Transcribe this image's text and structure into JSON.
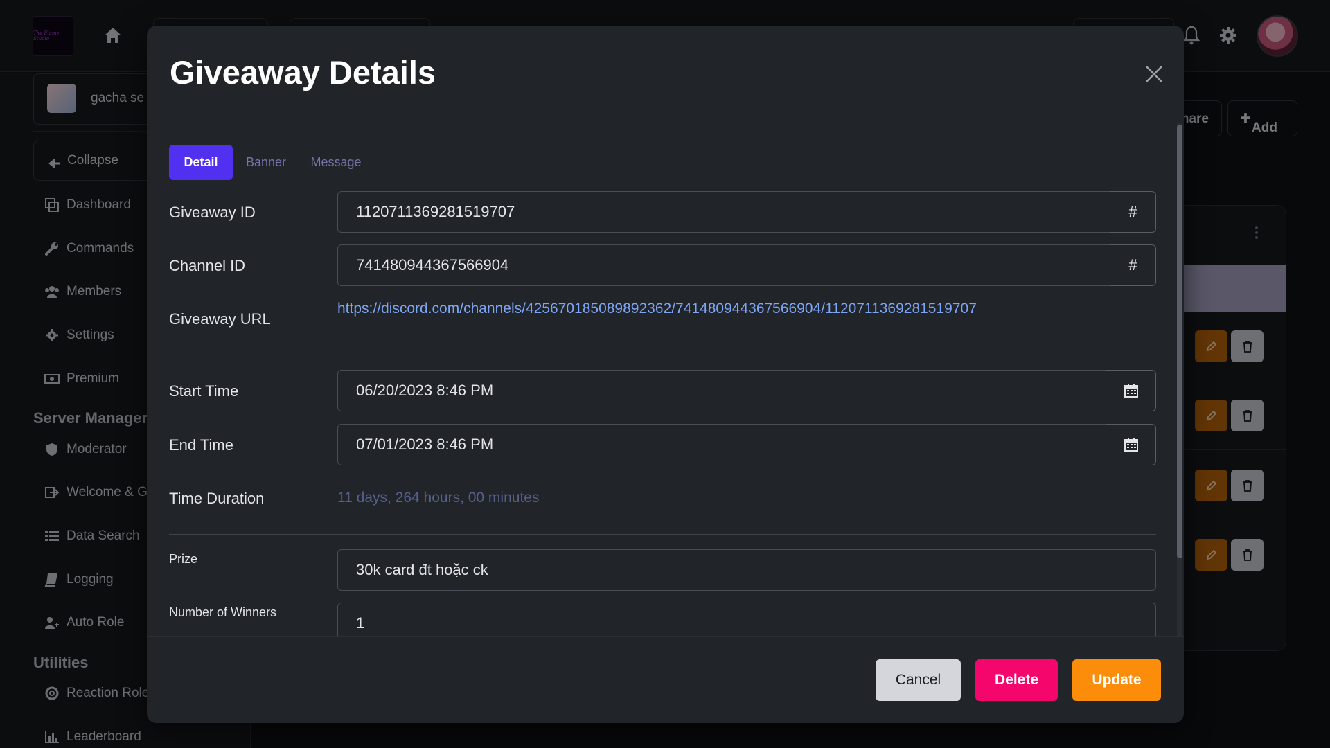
{
  "topbar": {
    "logo_text": "The Flame Studio"
  },
  "sidebar": {
    "server_name": "gacha se",
    "collapse_label": "Collapse",
    "items": [
      {
        "label": "Dashboard"
      },
      {
        "label": "Commands"
      },
      {
        "label": "Members"
      },
      {
        "label": "Settings"
      },
      {
        "label": "Premium"
      }
    ],
    "section_server": "Server Manager",
    "server_items": [
      {
        "label": "Moderator"
      },
      {
        "label": "Welcome & G"
      },
      {
        "label": "Data Search"
      },
      {
        "label": "Logging"
      },
      {
        "label": "Auto Role"
      }
    ],
    "section_utilities": "Utilities",
    "utility_items": [
      {
        "label": "Reaction Role"
      },
      {
        "label": "Leaderboard"
      }
    ]
  },
  "right": {
    "share_label": "hare",
    "add_label": "Add"
  },
  "modal": {
    "title": "Giveaway Details",
    "tabs": [
      "Detail",
      "Banner",
      "Message"
    ],
    "fields": {
      "giveaway_id_label": "Giveaway ID",
      "giveaway_id_value": "1120711369281519707",
      "channel_id_label": "Channel ID",
      "channel_id_value": "741480944367566904",
      "hash_symbol": "#",
      "giveaway_url_label": "Giveaway URL",
      "giveaway_url_value": "https://discord.com/channels/425670185089892362/741480944367566904/1120711369281519707",
      "start_time_label": "Start Time",
      "start_time_value": "06/20/2023 8:46 PM",
      "end_time_label": "End Time",
      "end_time_value": "07/01/2023 8:46 PM",
      "duration_label": "Time Duration",
      "duration_value": "11 days, 264 hours, 00 minutes",
      "prize_label": "Prize",
      "prize_value": "30k card đt hoặc ck",
      "winners_label": "Number of Winners",
      "winners_value": "1"
    },
    "buttons": {
      "cancel": "Cancel",
      "delete": "Delete",
      "update": "Update"
    }
  },
  "colors": {
    "accent": "#5230f0",
    "delete": "#f5066d",
    "update": "#fb8d0a",
    "link": "#7da6f5"
  }
}
